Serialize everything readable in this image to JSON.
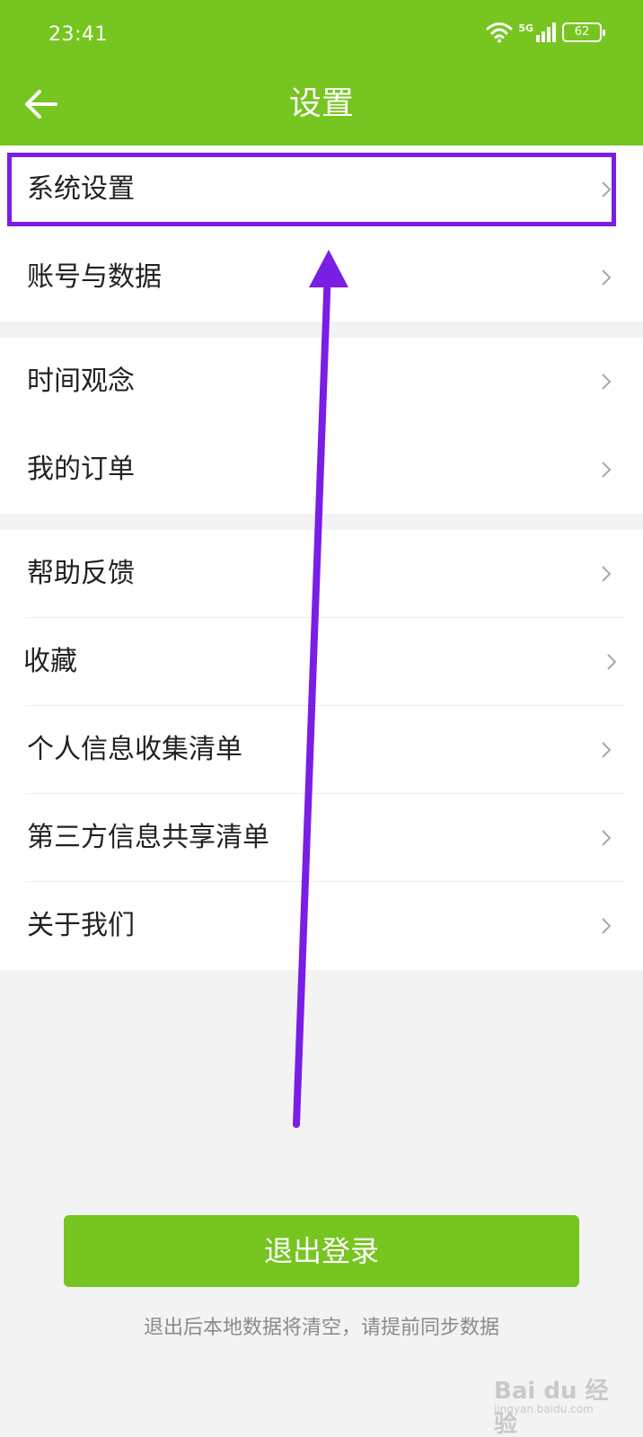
{
  "status_bar": {
    "time": "23:41",
    "network": "5G",
    "battery": "62"
  },
  "header": {
    "title": "设置",
    "back_icon": "arrow-left-icon"
  },
  "groups": [
    {
      "items": [
        {
          "label": "系统设置"
        },
        {
          "label": "账号与数据"
        }
      ]
    },
    {
      "items": [
        {
          "label": "时间观念"
        },
        {
          "label": "我的订单"
        }
      ]
    },
    {
      "items": [
        {
          "label": "帮助反馈"
        },
        {
          "label": "收藏"
        },
        {
          "label": "个人信息收集清单"
        },
        {
          "label": "第三方信息共享清单"
        },
        {
          "label": "关于我们"
        }
      ]
    }
  ],
  "logout": {
    "button_label": "退出登录",
    "hint": "退出后本地数据将清空，请提前同步数据"
  },
  "annotation": {
    "color": "#7a1ee6"
  },
  "watermark": {
    "main": "Bai du 经验",
    "sub": "jingyan.baidu.com"
  },
  "colors": {
    "brand": "#76c520",
    "background": "#f3f3f3"
  }
}
